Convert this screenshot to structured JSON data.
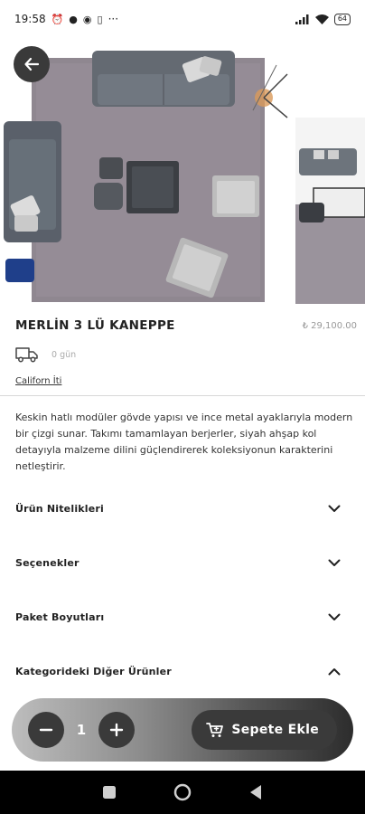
{
  "status_bar": {
    "time": "19:58",
    "battery": "64",
    "dots": "···"
  },
  "product": {
    "title": "MERLİN 3 LÜ KANEPPE",
    "price": "₺ 29,100.00",
    "delivery": "0 gün",
    "brand": "Californ İti",
    "description": "Keskin hatlı modüler gövde yapısı ve ince metal ayaklarıyla modern bir çizgi sunar. Takımı tamamlayan berjerler, siyah ahşap kol detayıyla malzeme dilini güçlendirerek koleksiyonun karakterini netleştirir."
  },
  "accordion": [
    {
      "label": "Ürün Nitelikleri",
      "expanded": false
    },
    {
      "label": "Seçenekler",
      "expanded": false
    },
    {
      "label": "Paket Boyutları",
      "expanded": false
    },
    {
      "label": "Kategorideki Diğer Ürünler",
      "expanded": true
    }
  ],
  "cart": {
    "quantity": "1",
    "add_label": "Sepete Ekle"
  },
  "icons": {
    "back": "arrow-left-icon",
    "minus": "minus-icon",
    "plus": "plus-icon",
    "cart": "cart-add-icon",
    "truck": "truck-icon"
  }
}
